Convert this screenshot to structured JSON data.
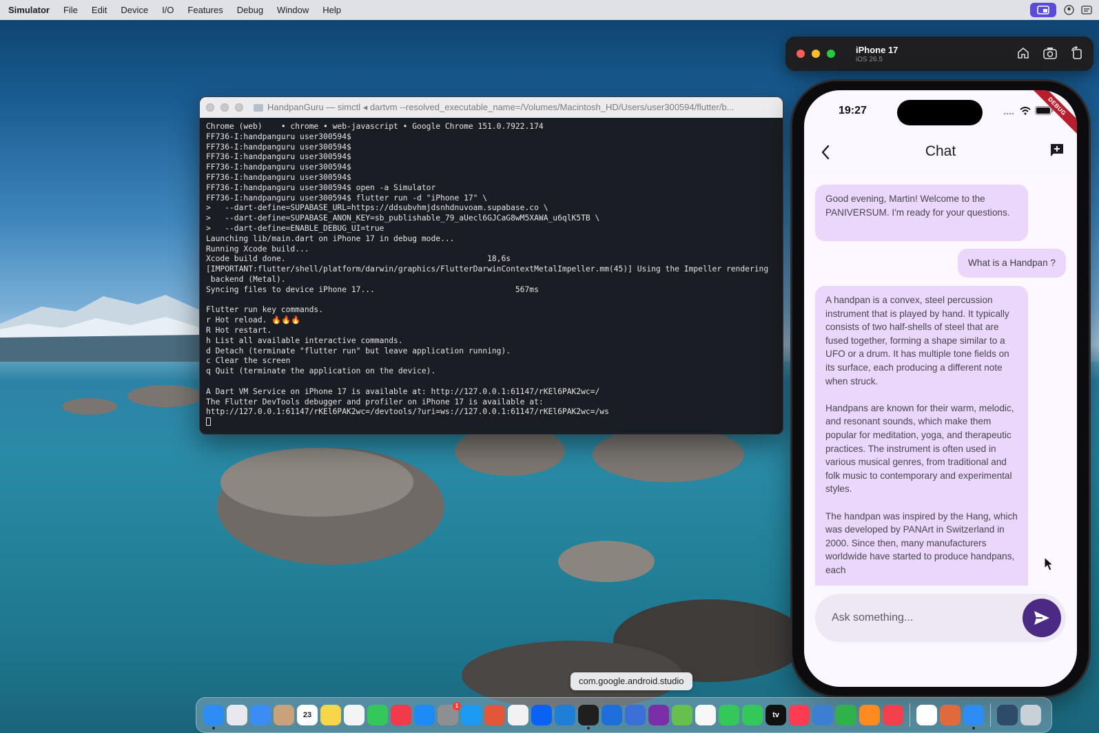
{
  "menubar": {
    "app_name": "Simulator",
    "items": [
      "File",
      "Edit",
      "Device",
      "I/O",
      "Features",
      "Debug",
      "Window",
      "Help"
    ]
  },
  "terminal": {
    "title": "HandpanGuru — simctl ◂ dartvm --resolved_executable_name=/Volumes/Macintosh_HD/Users/user300594/flutter/b...",
    "lines": [
      "Chrome (web)    • chrome • web-javascript • Google Chrome 151.0.7922.174",
      "FF736-I:handpanguru user300594$",
      "FF736-I:handpanguru user300594$",
      "FF736-I:handpanguru user300594$",
      "FF736-I:handpanguru user300594$",
      "FF736-I:handpanguru user300594$",
      "FF736-I:handpanguru user300594$ open -a Simulator",
      "FF736-I:handpanguru user300594$ flutter run -d \"iPhone 17\" \\",
      ">   --dart-define=SUPABASE_URL=https://ddsubvhmjdsnhdnuvoam.supabase.co \\",
      ">   --dart-define=SUPABASE_ANON_KEY=sb_publishable_79_aUecl6GJCaG8wM5XAWA_u6qlK5TB \\",
      ">   --dart-define=ENABLE_DEBUG_UI=true",
      "Launching lib/main.dart on iPhone 17 in debug mode...",
      "Running Xcode build...",
      "Xcode build done.                                           18,6s",
      "[IMPORTANT:flutter/shell/platform/darwin/graphics/FlutterDarwinContextMetalImpeller.mm(45)] Using the Impeller rendering",
      " backend (Metal).",
      "Syncing files to device iPhone 17...                              567ms",
      "",
      "Flutter run key commands.",
      "r Hot reload. 🔥🔥🔥",
      "R Hot restart.",
      "h List all available interactive commands.",
      "d Detach (terminate \"flutter run\" but leave application running).",
      "c Clear the screen",
      "q Quit (terminate the application on the device).",
      "",
      "A Dart VM Service on iPhone 17 is available at: http://127.0.0.1:61147/rKEl6PAK2wc=/",
      "The Flutter DevTools debugger and profiler on iPhone 17 is available at:",
      "http://127.0.0.1:61147/rKEl6PAK2wc=/devtools/?uri=ws://127.0.0.1:61147/rKEl6PAK2wc=/ws"
    ]
  },
  "simulator": {
    "device_name": "iPhone 17",
    "device_os": "iOS 26.5"
  },
  "phone": {
    "time": "19:27",
    "debug_label": "DEBUG",
    "title": "Chat",
    "messages": [
      {
        "role": "bot",
        "text": "Good evening, Martin! Welcome to the PANIVERSUM. I'm ready for your questions."
      },
      {
        "role": "user",
        "text": "What is a Handpan ?"
      },
      {
        "role": "bot",
        "text": "A handpan is a convex, steel percussion instrument that is played by hand. It typically consists of two half-shells of steel that are fused together, forming a shape similar to a UFO or a drum. It has multiple tone fields on its surface, each producing a different note when struck.\n\nHandpans are known for their warm, melodic, and resonant sounds, which make them popular for meditation, yoga, and therapeutic practices. The instrument is often used in various musical genres, from traditional and folk music to contemporary and experimental styles.\n\nThe handpan was inspired by the Hang, which was developed by PANArt in Switzerland in 2000. Since then, many manufacturers worldwide have started to produce handpans, each"
      }
    ],
    "input_placeholder": "Ask something...",
    "accent": "#4b2a84",
    "bubble_color": "#ead7fb"
  },
  "tooltip": "com.google.android.studio",
  "dock": {
    "icons": [
      {
        "name": "finder-icon",
        "color": "#2c8cf2",
        "running": true
      },
      {
        "name": "launchpad-icon",
        "color": "#e8e8ee",
        "running": false
      },
      {
        "name": "mail-icon",
        "color": "#3b8df5",
        "running": false
      },
      {
        "name": "contacts-icon",
        "color": "#c7a27a",
        "running": false
      },
      {
        "name": "calendar-icon",
        "color": "#ffffff",
        "running": false,
        "label": "23"
      },
      {
        "name": "notes-icon",
        "color": "#f7d64a",
        "running": false
      },
      {
        "name": "reminders-icon",
        "color": "#f4f4f4",
        "running": false
      },
      {
        "name": "messages-icon",
        "color": "#34c759",
        "running": false
      },
      {
        "name": "news-icon",
        "color": "#f33a4a",
        "running": false
      },
      {
        "name": "appstore-icon",
        "color": "#1d8af5",
        "running": false
      },
      {
        "name": "system-settings-icon",
        "color": "#8e8e93",
        "running": false,
        "badge": "1"
      },
      {
        "name": "safari-icon",
        "color": "#1c9bf5",
        "running": false
      },
      {
        "name": "firefox-icon",
        "color": "#e2573a",
        "running": false
      },
      {
        "name": "chrome-icon",
        "color": "#f2f2f2",
        "running": false
      },
      {
        "name": "dropbox-icon",
        "color": "#0a62f5",
        "running": false
      },
      {
        "name": "vscode-icon",
        "color": "#1f7fd6",
        "running": false
      },
      {
        "name": "terminal-icon",
        "color": "#1f1f1f",
        "running": true
      },
      {
        "name": "xcode-icon",
        "color": "#1e6fd9",
        "running": false
      },
      {
        "name": "instruments-icon",
        "color": "#3c6fd8",
        "running": false
      },
      {
        "name": "affinity-icon",
        "color": "#7a2ea8",
        "running": false
      },
      {
        "name": "maps-icon",
        "color": "#67c04d",
        "running": false
      },
      {
        "name": "photos-icon",
        "color": "#f7f7f7",
        "running": false
      },
      {
        "name": "facetime-icon",
        "color": "#34c759",
        "running": false
      },
      {
        "name": "phone-icon",
        "color": "#34c759",
        "running": false
      },
      {
        "name": "appletv-icon",
        "color": "#111111",
        "running": false,
        "label": "tv"
      },
      {
        "name": "music-icon",
        "color": "#fc3c53",
        "running": false
      },
      {
        "name": "android-studio-icon",
        "color": "#3c7fd2",
        "running": false
      },
      {
        "name": "numbers-icon",
        "color": "#2fb24a",
        "running": false
      },
      {
        "name": "pages-icon",
        "color": "#ff8a1f",
        "running": false
      },
      {
        "name": "rocket-icon",
        "color": "#f2404d",
        "running": false
      }
    ],
    "apps_after_separator": [
      {
        "name": "chatgpt-icon",
        "color": "#ffffff",
        "running": false
      },
      {
        "name": "claude-icon",
        "color": "#e06a3c",
        "running": false
      },
      {
        "name": "simulator-icon",
        "color": "#2c8cf2",
        "running": true
      }
    ],
    "trailing": [
      {
        "name": "downloads-folder-icon",
        "color": "#2f4b6a",
        "running": false
      },
      {
        "name": "trash-icon",
        "color": "#c8d0d8",
        "running": false
      }
    ]
  }
}
